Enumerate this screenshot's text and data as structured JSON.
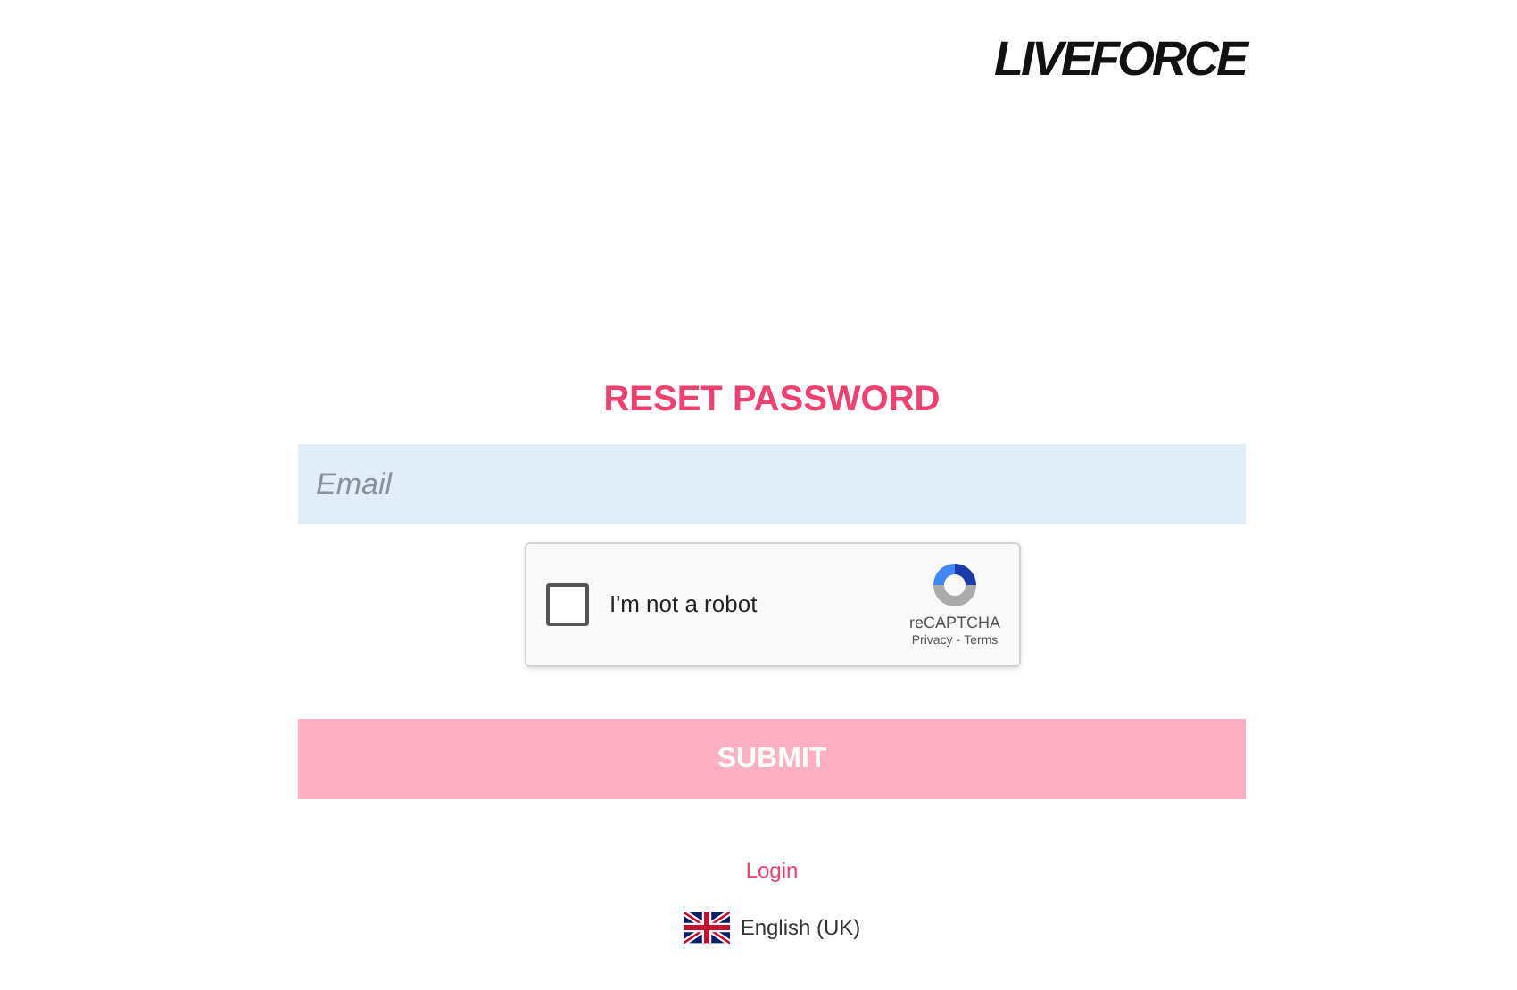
{
  "logo": "LIVEFORCE",
  "heading": "RESET PASSWORD",
  "email": {
    "placeholder": "Email"
  },
  "captcha": {
    "label": "I'm not a robot",
    "checked": false,
    "brand": "reCAPTCHA",
    "privacy": "Privacy",
    "separator": "-",
    "terms": "Terms"
  },
  "submit": {
    "label": "SUBMIT",
    "disabled": true
  },
  "login_link": "Login",
  "language": "English (UK)"
}
